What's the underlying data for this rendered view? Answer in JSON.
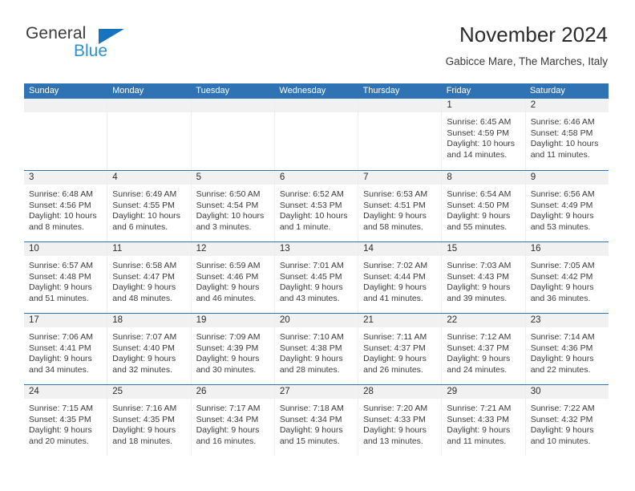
{
  "brand": {
    "name_top": "General",
    "name_bottom": "Blue",
    "triangle_color": "#1673bd",
    "top_color": "#3c3c3c",
    "bottom_color": "#2e8fd4"
  },
  "header": {
    "title": "November 2024",
    "subtitle": "Gabicce Mare, The Marches, Italy"
  },
  "theme": {
    "accent": "#3073b4",
    "daynum_band": "#f1f1f1",
    "text": "#3a3a3a"
  },
  "calendar": {
    "weekday_headers": [
      "Sunday",
      "Monday",
      "Tuesday",
      "Wednesday",
      "Thursday",
      "Friday",
      "Saturday"
    ],
    "weeks": [
      [
        {
          "day": "",
          "lines": []
        },
        {
          "day": "",
          "lines": []
        },
        {
          "day": "",
          "lines": []
        },
        {
          "day": "",
          "lines": []
        },
        {
          "day": "",
          "lines": []
        },
        {
          "day": "1",
          "lines": [
            "Sunrise: 6:45 AM",
            "Sunset: 4:59 PM",
            "Daylight: 10 hours",
            "and 14 minutes."
          ]
        },
        {
          "day": "2",
          "lines": [
            "Sunrise: 6:46 AM",
            "Sunset: 4:58 PM",
            "Daylight: 10 hours",
            "and 11 minutes."
          ]
        }
      ],
      [
        {
          "day": "3",
          "lines": [
            "Sunrise: 6:48 AM",
            "Sunset: 4:56 PM",
            "Daylight: 10 hours",
            "and 8 minutes."
          ]
        },
        {
          "day": "4",
          "lines": [
            "Sunrise: 6:49 AM",
            "Sunset: 4:55 PM",
            "Daylight: 10 hours",
            "and 6 minutes."
          ]
        },
        {
          "day": "5",
          "lines": [
            "Sunrise: 6:50 AM",
            "Sunset: 4:54 PM",
            "Daylight: 10 hours",
            "and 3 minutes."
          ]
        },
        {
          "day": "6",
          "lines": [
            "Sunrise: 6:52 AM",
            "Sunset: 4:53 PM",
            "Daylight: 10 hours",
            "and 1 minute."
          ]
        },
        {
          "day": "7",
          "lines": [
            "Sunrise: 6:53 AM",
            "Sunset: 4:51 PM",
            "Daylight: 9 hours",
            "and 58 minutes."
          ]
        },
        {
          "day": "8",
          "lines": [
            "Sunrise: 6:54 AM",
            "Sunset: 4:50 PM",
            "Daylight: 9 hours",
            "and 55 minutes."
          ]
        },
        {
          "day": "9",
          "lines": [
            "Sunrise: 6:56 AM",
            "Sunset: 4:49 PM",
            "Daylight: 9 hours",
            "and 53 minutes."
          ]
        }
      ],
      [
        {
          "day": "10",
          "lines": [
            "Sunrise: 6:57 AM",
            "Sunset: 4:48 PM",
            "Daylight: 9 hours",
            "and 51 minutes."
          ]
        },
        {
          "day": "11",
          "lines": [
            "Sunrise: 6:58 AM",
            "Sunset: 4:47 PM",
            "Daylight: 9 hours",
            "and 48 minutes."
          ]
        },
        {
          "day": "12",
          "lines": [
            "Sunrise: 6:59 AM",
            "Sunset: 4:46 PM",
            "Daylight: 9 hours",
            "and 46 minutes."
          ]
        },
        {
          "day": "13",
          "lines": [
            "Sunrise: 7:01 AM",
            "Sunset: 4:45 PM",
            "Daylight: 9 hours",
            "and 43 minutes."
          ]
        },
        {
          "day": "14",
          "lines": [
            "Sunrise: 7:02 AM",
            "Sunset: 4:44 PM",
            "Daylight: 9 hours",
            "and 41 minutes."
          ]
        },
        {
          "day": "15",
          "lines": [
            "Sunrise: 7:03 AM",
            "Sunset: 4:43 PM",
            "Daylight: 9 hours",
            "and 39 minutes."
          ]
        },
        {
          "day": "16",
          "lines": [
            "Sunrise: 7:05 AM",
            "Sunset: 4:42 PM",
            "Daylight: 9 hours",
            "and 36 minutes."
          ]
        }
      ],
      [
        {
          "day": "17",
          "lines": [
            "Sunrise: 7:06 AM",
            "Sunset: 4:41 PM",
            "Daylight: 9 hours",
            "and 34 minutes."
          ]
        },
        {
          "day": "18",
          "lines": [
            "Sunrise: 7:07 AM",
            "Sunset: 4:40 PM",
            "Daylight: 9 hours",
            "and 32 minutes."
          ]
        },
        {
          "day": "19",
          "lines": [
            "Sunrise: 7:09 AM",
            "Sunset: 4:39 PM",
            "Daylight: 9 hours",
            "and 30 minutes."
          ]
        },
        {
          "day": "20",
          "lines": [
            "Sunrise: 7:10 AM",
            "Sunset: 4:38 PM",
            "Daylight: 9 hours",
            "and 28 minutes."
          ]
        },
        {
          "day": "21",
          "lines": [
            "Sunrise: 7:11 AM",
            "Sunset: 4:37 PM",
            "Daylight: 9 hours",
            "and 26 minutes."
          ]
        },
        {
          "day": "22",
          "lines": [
            "Sunrise: 7:12 AM",
            "Sunset: 4:37 PM",
            "Daylight: 9 hours",
            "and 24 minutes."
          ]
        },
        {
          "day": "23",
          "lines": [
            "Sunrise: 7:14 AM",
            "Sunset: 4:36 PM",
            "Daylight: 9 hours",
            "and 22 minutes."
          ]
        }
      ],
      [
        {
          "day": "24",
          "lines": [
            "Sunrise: 7:15 AM",
            "Sunset: 4:35 PM",
            "Daylight: 9 hours",
            "and 20 minutes."
          ]
        },
        {
          "day": "25",
          "lines": [
            "Sunrise: 7:16 AM",
            "Sunset: 4:35 PM",
            "Daylight: 9 hours",
            "and 18 minutes."
          ]
        },
        {
          "day": "26",
          "lines": [
            "Sunrise: 7:17 AM",
            "Sunset: 4:34 PM",
            "Daylight: 9 hours",
            "and 16 minutes."
          ]
        },
        {
          "day": "27",
          "lines": [
            "Sunrise: 7:18 AM",
            "Sunset: 4:34 PM",
            "Daylight: 9 hours",
            "and 15 minutes."
          ]
        },
        {
          "day": "28",
          "lines": [
            "Sunrise: 7:20 AM",
            "Sunset: 4:33 PM",
            "Daylight: 9 hours",
            "and 13 minutes."
          ]
        },
        {
          "day": "29",
          "lines": [
            "Sunrise: 7:21 AM",
            "Sunset: 4:33 PM",
            "Daylight: 9 hours",
            "and 11 minutes."
          ]
        },
        {
          "day": "30",
          "lines": [
            "Sunrise: 7:22 AM",
            "Sunset: 4:32 PM",
            "Daylight: 9 hours",
            "and 10 minutes."
          ]
        }
      ]
    ]
  }
}
